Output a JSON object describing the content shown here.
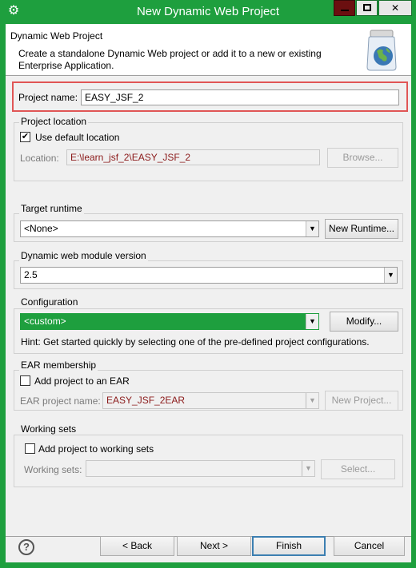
{
  "window": {
    "title": "New Dynamic Web Project",
    "minimize_glyph": "",
    "maximize_glyph": "",
    "close_glyph": "✕"
  },
  "header": {
    "title": "Dynamic Web Project",
    "description": "Create a standalone Dynamic Web project or add it to a new or existing Enterprise Application."
  },
  "project_name": {
    "label": "Project name:",
    "value": "EASY_JSF_2"
  },
  "project_location": {
    "group_title": "Project location",
    "use_default_label": "Use default location",
    "use_default_checked": "✔",
    "location_label": "Location:",
    "location_value": "E:\\learn_jsf_2\\EASY_JSF_2",
    "browse_label": "Browse..."
  },
  "target_runtime": {
    "group_title": "Target runtime",
    "selected": "<None>",
    "new_runtime_label": "New Runtime..."
  },
  "module_version": {
    "group_title": "Dynamic web module version",
    "selected": "2.5"
  },
  "configuration": {
    "group_title": "Configuration",
    "selected": "<custom>",
    "modify_label": "Modify...",
    "hint": "Hint: Get started quickly by selecting one of the pre-defined project configurations."
  },
  "ear_membership": {
    "group_title": "EAR membership",
    "add_label": "Add project to an EAR",
    "ear_name_label": "EAR project name:",
    "ear_name_value": "EASY_JSF_2EAR",
    "new_project_label": "New Project..."
  },
  "working_sets": {
    "group_title": "Working sets",
    "add_label": "Add project to working sets",
    "sets_label": "Working sets:",
    "sets_value": "",
    "select_label": "Select..."
  },
  "footer": {
    "help_glyph": "?",
    "back_label": "< Back",
    "next_label": "Next >",
    "finish_label": "Finish",
    "cancel_label": "Cancel"
  },
  "icons": {
    "app_icon": "gear-icon",
    "wizard_icon": "jar-globe-icon",
    "dropdown_arrow": "▼"
  },
  "colors": {
    "accent": "#1e9f3e",
    "highlight_border": "#e05555",
    "disabled_value_text": "#8b1a1a"
  }
}
